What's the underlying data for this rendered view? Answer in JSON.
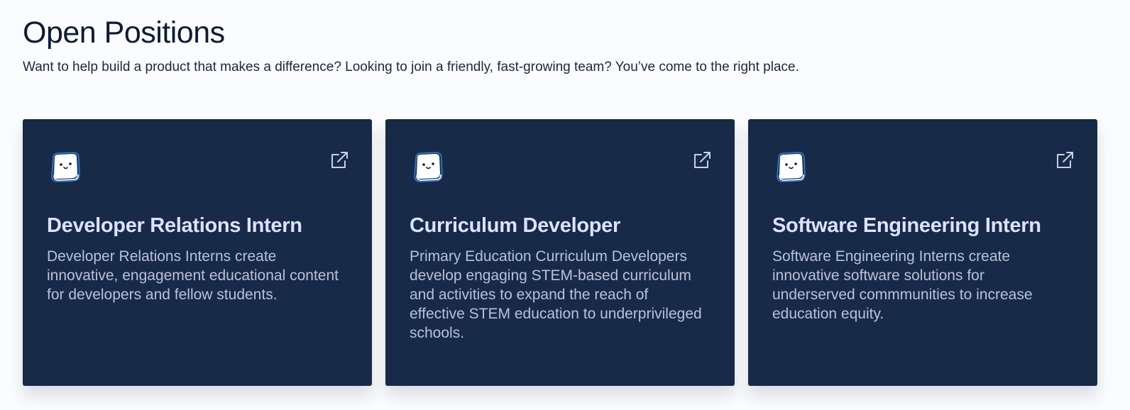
{
  "header": {
    "title": "Open Positions",
    "subtitle": "Want to help build a product that makes a difference? Looking to join a friendly, fast-growing team? You’ve come to the right place."
  },
  "positions": [
    {
      "title": "Developer Relations Intern",
      "description": "Developer Relations Interns create innovative, engagement educational content for developers and fellow students.",
      "logo_icon": "cube-mascot-icon",
      "link_icon": "external-link-icon"
    },
    {
      "title": "Curriculum Developer",
      "description": "Primary Education Curriculum Developers develop engaging STEM-based curriculum and activities to expand the reach of effective STEM education to underprivileged schools.",
      "logo_icon": "cube-mascot-icon",
      "link_icon": "external-link-icon"
    },
    {
      "title": "Software Engineering Intern",
      "description": "Software Engineering Interns create innovative software solutions for underserved commmunities to increase education equity.",
      "logo_icon": "cube-mascot-icon",
      "link_icon": "external-link-icon"
    }
  ],
  "colors": {
    "page_background": "#fbfcfe",
    "card_background": "#172a47",
    "card_title": "#dbe3ff",
    "card_text": "#b8c2d9",
    "heading": "#0f1b33"
  }
}
